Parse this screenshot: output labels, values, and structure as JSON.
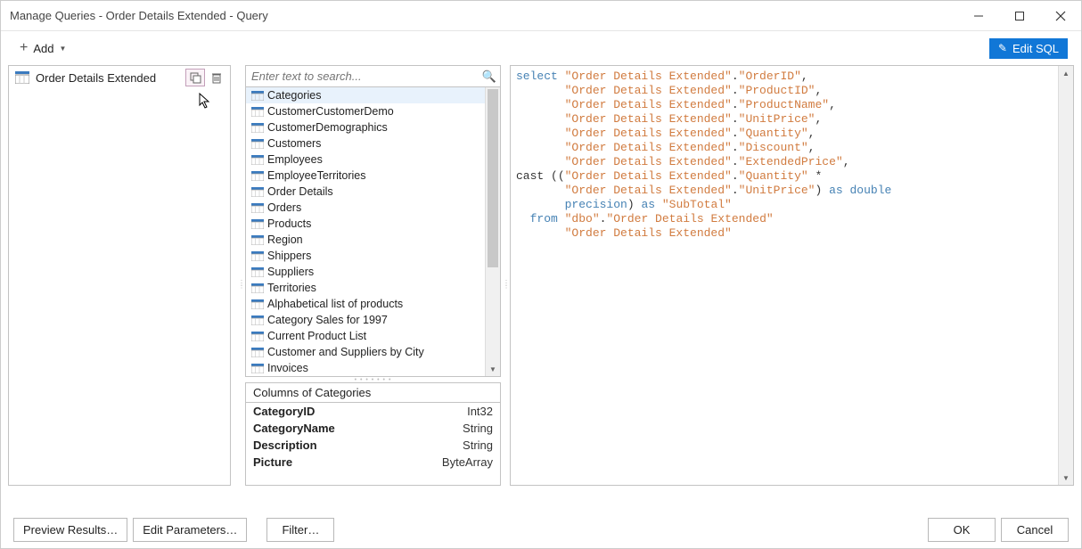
{
  "window": {
    "title": "Manage Queries - Order Details Extended - Query"
  },
  "toolbar": {
    "add_label": "Add",
    "edit_sql_label": "Edit SQL"
  },
  "queries": {
    "items": [
      {
        "name": "Order Details Extended"
      }
    ]
  },
  "search": {
    "placeholder": "Enter text to search..."
  },
  "tables": {
    "items": [
      "Categories",
      "CustomerCustomerDemo",
      "CustomerDemographics",
      "Customers",
      "Employees",
      "EmployeeTerritories",
      "Order Details",
      "Orders",
      "Products",
      "Region",
      "Shippers",
      "Suppliers",
      "Territories",
      "Alphabetical list of products",
      "Category Sales for 1997",
      "Current Product List",
      "Customer and Suppliers by City",
      "Invoices"
    ],
    "selected_index": 0
  },
  "columns": {
    "header": "Columns of Categories",
    "rows": [
      {
        "name": "CategoryID",
        "type": "Int32"
      },
      {
        "name": "CategoryName",
        "type": "String"
      },
      {
        "name": "Description",
        "type": "String"
      },
      {
        "name": "Picture",
        "type": "ByteArray"
      }
    ]
  },
  "sql": {
    "tokens": [
      {
        "c": "kw",
        "t": "select "
      },
      {
        "c": "str",
        "t": "\"Order Details Extended\""
      },
      {
        "c": "op",
        "t": "."
      },
      {
        "c": "str",
        "t": "\"OrderID\""
      },
      {
        "c": "op",
        "t": ","
      },
      {
        "c": "",
        "t": "\n       "
      },
      {
        "c": "str",
        "t": "\"Order Details Extended\""
      },
      {
        "c": "op",
        "t": "."
      },
      {
        "c": "str",
        "t": "\"ProductID\""
      },
      {
        "c": "op",
        "t": ","
      },
      {
        "c": "",
        "t": "\n       "
      },
      {
        "c": "str",
        "t": "\"Order Details Extended\""
      },
      {
        "c": "op",
        "t": "."
      },
      {
        "c": "str",
        "t": "\"ProductName\""
      },
      {
        "c": "op",
        "t": ","
      },
      {
        "c": "",
        "t": "\n       "
      },
      {
        "c": "str",
        "t": "\"Order Details Extended\""
      },
      {
        "c": "op",
        "t": "."
      },
      {
        "c": "str",
        "t": "\"UnitPrice\""
      },
      {
        "c": "op",
        "t": ","
      },
      {
        "c": "",
        "t": "\n       "
      },
      {
        "c": "str",
        "t": "\"Order Details Extended\""
      },
      {
        "c": "op",
        "t": "."
      },
      {
        "c": "str",
        "t": "\"Quantity\""
      },
      {
        "c": "op",
        "t": ","
      },
      {
        "c": "",
        "t": "\n       "
      },
      {
        "c": "str",
        "t": "\"Order Details Extended\""
      },
      {
        "c": "op",
        "t": "."
      },
      {
        "c": "str",
        "t": "\"Discount\""
      },
      {
        "c": "op",
        "t": ","
      },
      {
        "c": "",
        "t": "\n       "
      },
      {
        "c": "str",
        "t": "\"Order Details Extended\""
      },
      {
        "c": "op",
        "t": "."
      },
      {
        "c": "str",
        "t": "\"ExtendedPrice\""
      },
      {
        "c": "op",
        "t": ","
      },
      {
        "c": "",
        "t": "\n"
      },
      {
        "c": "cast",
        "t": "cast "
      },
      {
        "c": "op",
        "t": "(("
      },
      {
        "c": "str",
        "t": "\"Order Details Extended\""
      },
      {
        "c": "op",
        "t": "."
      },
      {
        "c": "str",
        "t": "\"Quantity\""
      },
      {
        "c": "op",
        "t": " *"
      },
      {
        "c": "",
        "t": "\n       "
      },
      {
        "c": "str",
        "t": "\"Order Details Extended\""
      },
      {
        "c": "op",
        "t": "."
      },
      {
        "c": "str",
        "t": "\"UnitPrice\""
      },
      {
        "c": "op",
        "t": ") "
      },
      {
        "c": "kw",
        "t": "as double"
      },
      {
        "c": "",
        "t": "\n       "
      },
      {
        "c": "kw",
        "t": "precision"
      },
      {
        "c": "op",
        "t": ") "
      },
      {
        "c": "kw",
        "t": "as "
      },
      {
        "c": "str",
        "t": "\"SubTotal\""
      },
      {
        "c": "",
        "t": "\n  "
      },
      {
        "c": "kw",
        "t": "from "
      },
      {
        "c": "str",
        "t": "\"dbo\""
      },
      {
        "c": "op",
        "t": "."
      },
      {
        "c": "str",
        "t": "\"Order Details Extended\""
      },
      {
        "c": "",
        "t": "\n       "
      },
      {
        "c": "str",
        "t": "\"Order Details Extended\""
      }
    ]
  },
  "buttons": {
    "preview": "Preview Results…",
    "edit_params": "Edit Parameters…",
    "filter": "Filter…",
    "ok": "OK",
    "cancel": "Cancel"
  }
}
